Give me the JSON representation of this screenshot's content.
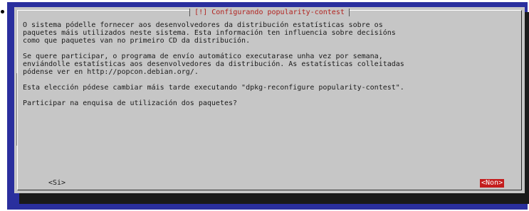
{
  "dialog": {
    "title": "[!] Configurando popularity-contest",
    "paragraphs": [
      "O sistema pódelle fornecer aos desenvolvedores da distribución estatísticas sobre os\npaquetes máis utilizados neste sistema. Esta información ten influencia sobre decisións\ncomo que paquetes van no primeiro CD da distribución.",
      "Se quere participar, o programa de envío automático executarase unha vez por semana,\nenviándolle estatísticas aos desenvolvedores da distribución. As estatísticas colleitadas\npódense ver en http://popcon.debian.org/.",
      "Esta elección pódese cambiar máis tarde executando \"dpkg-reconfigure popularity-contest\"."
    ],
    "question": "Participar na enquisa de utilización dos paquetes?",
    "buttons": {
      "yes": "<Si>",
      "no": "<Non>"
    }
  },
  "colors": {
    "screen_background": "#2a2f9e",
    "dialog_background": "#c6c6c6",
    "title_text": "#b2231f",
    "selected_button_background": "#c41d1d"
  }
}
